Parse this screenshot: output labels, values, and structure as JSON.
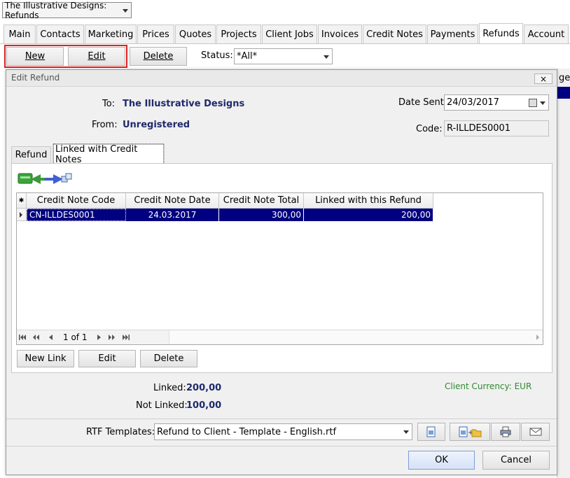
{
  "app": {
    "window_title": "The Illustrative Designs: Refunds"
  },
  "tabs": [
    {
      "label": "Main"
    },
    {
      "label": "Contacts"
    },
    {
      "label": "Marketing"
    },
    {
      "label": "Prices"
    },
    {
      "label": "Quotes"
    },
    {
      "label": "Projects"
    },
    {
      "label": "Client Jobs"
    },
    {
      "label": "Invoices"
    },
    {
      "label": "Credit Notes"
    },
    {
      "label": "Payments"
    },
    {
      "label": "Refunds"
    },
    {
      "label": "Account"
    }
  ],
  "toolbar": {
    "new_label": "New",
    "edit_label": "Edit",
    "delete_label": "Delete",
    "status_label": "Status:",
    "status_value": "*All*"
  },
  "background": {
    "right_edge_text": "ge"
  },
  "dialog": {
    "title": "Edit Refund",
    "close_glyph": "×",
    "to_label": "To:",
    "to_value": "The Illustrative Designs",
    "from_label": "From:",
    "from_value": "Unregistered",
    "date_sent_label": "Date Sent:",
    "date_sent_value": "24/03/2017",
    "code_label": "Code:",
    "code_value": "R-ILLDES0001",
    "inner_tabs": [
      {
        "label": "Refund"
      },
      {
        "label": "Linked with Credit Notes"
      }
    ],
    "grid": {
      "marker_header": "✱",
      "columns": [
        "Credit Note Code",
        "Credit Note Date",
        "Credit Note Total",
        "Linked with this Refund"
      ],
      "rows": [
        {
          "code": "CN-ILLDES0001",
          "date": "24.03.2017",
          "total": "300,00",
          "linked": "200,00"
        }
      ],
      "pager": "1 of 1"
    },
    "link_buttons": {
      "new_link": "New Link",
      "edit": "Edit",
      "delete": "Delete"
    },
    "linked_label": "Linked:",
    "linked_value": "200,00",
    "not_linked_label": "Not Linked:",
    "not_linked_value": "100,00",
    "currency_text": "Client Currency: EUR",
    "rtf_label": "RTF Templates:",
    "rtf_value": "Refund to Client - Template - English.rtf",
    "ok_label": "OK",
    "cancel_label": "Cancel"
  },
  "colors": {
    "accent": "#000080",
    "highlight_border": "#e02020",
    "currency_text": "#2e8b2e",
    "value_text": "#1f2a6b"
  }
}
